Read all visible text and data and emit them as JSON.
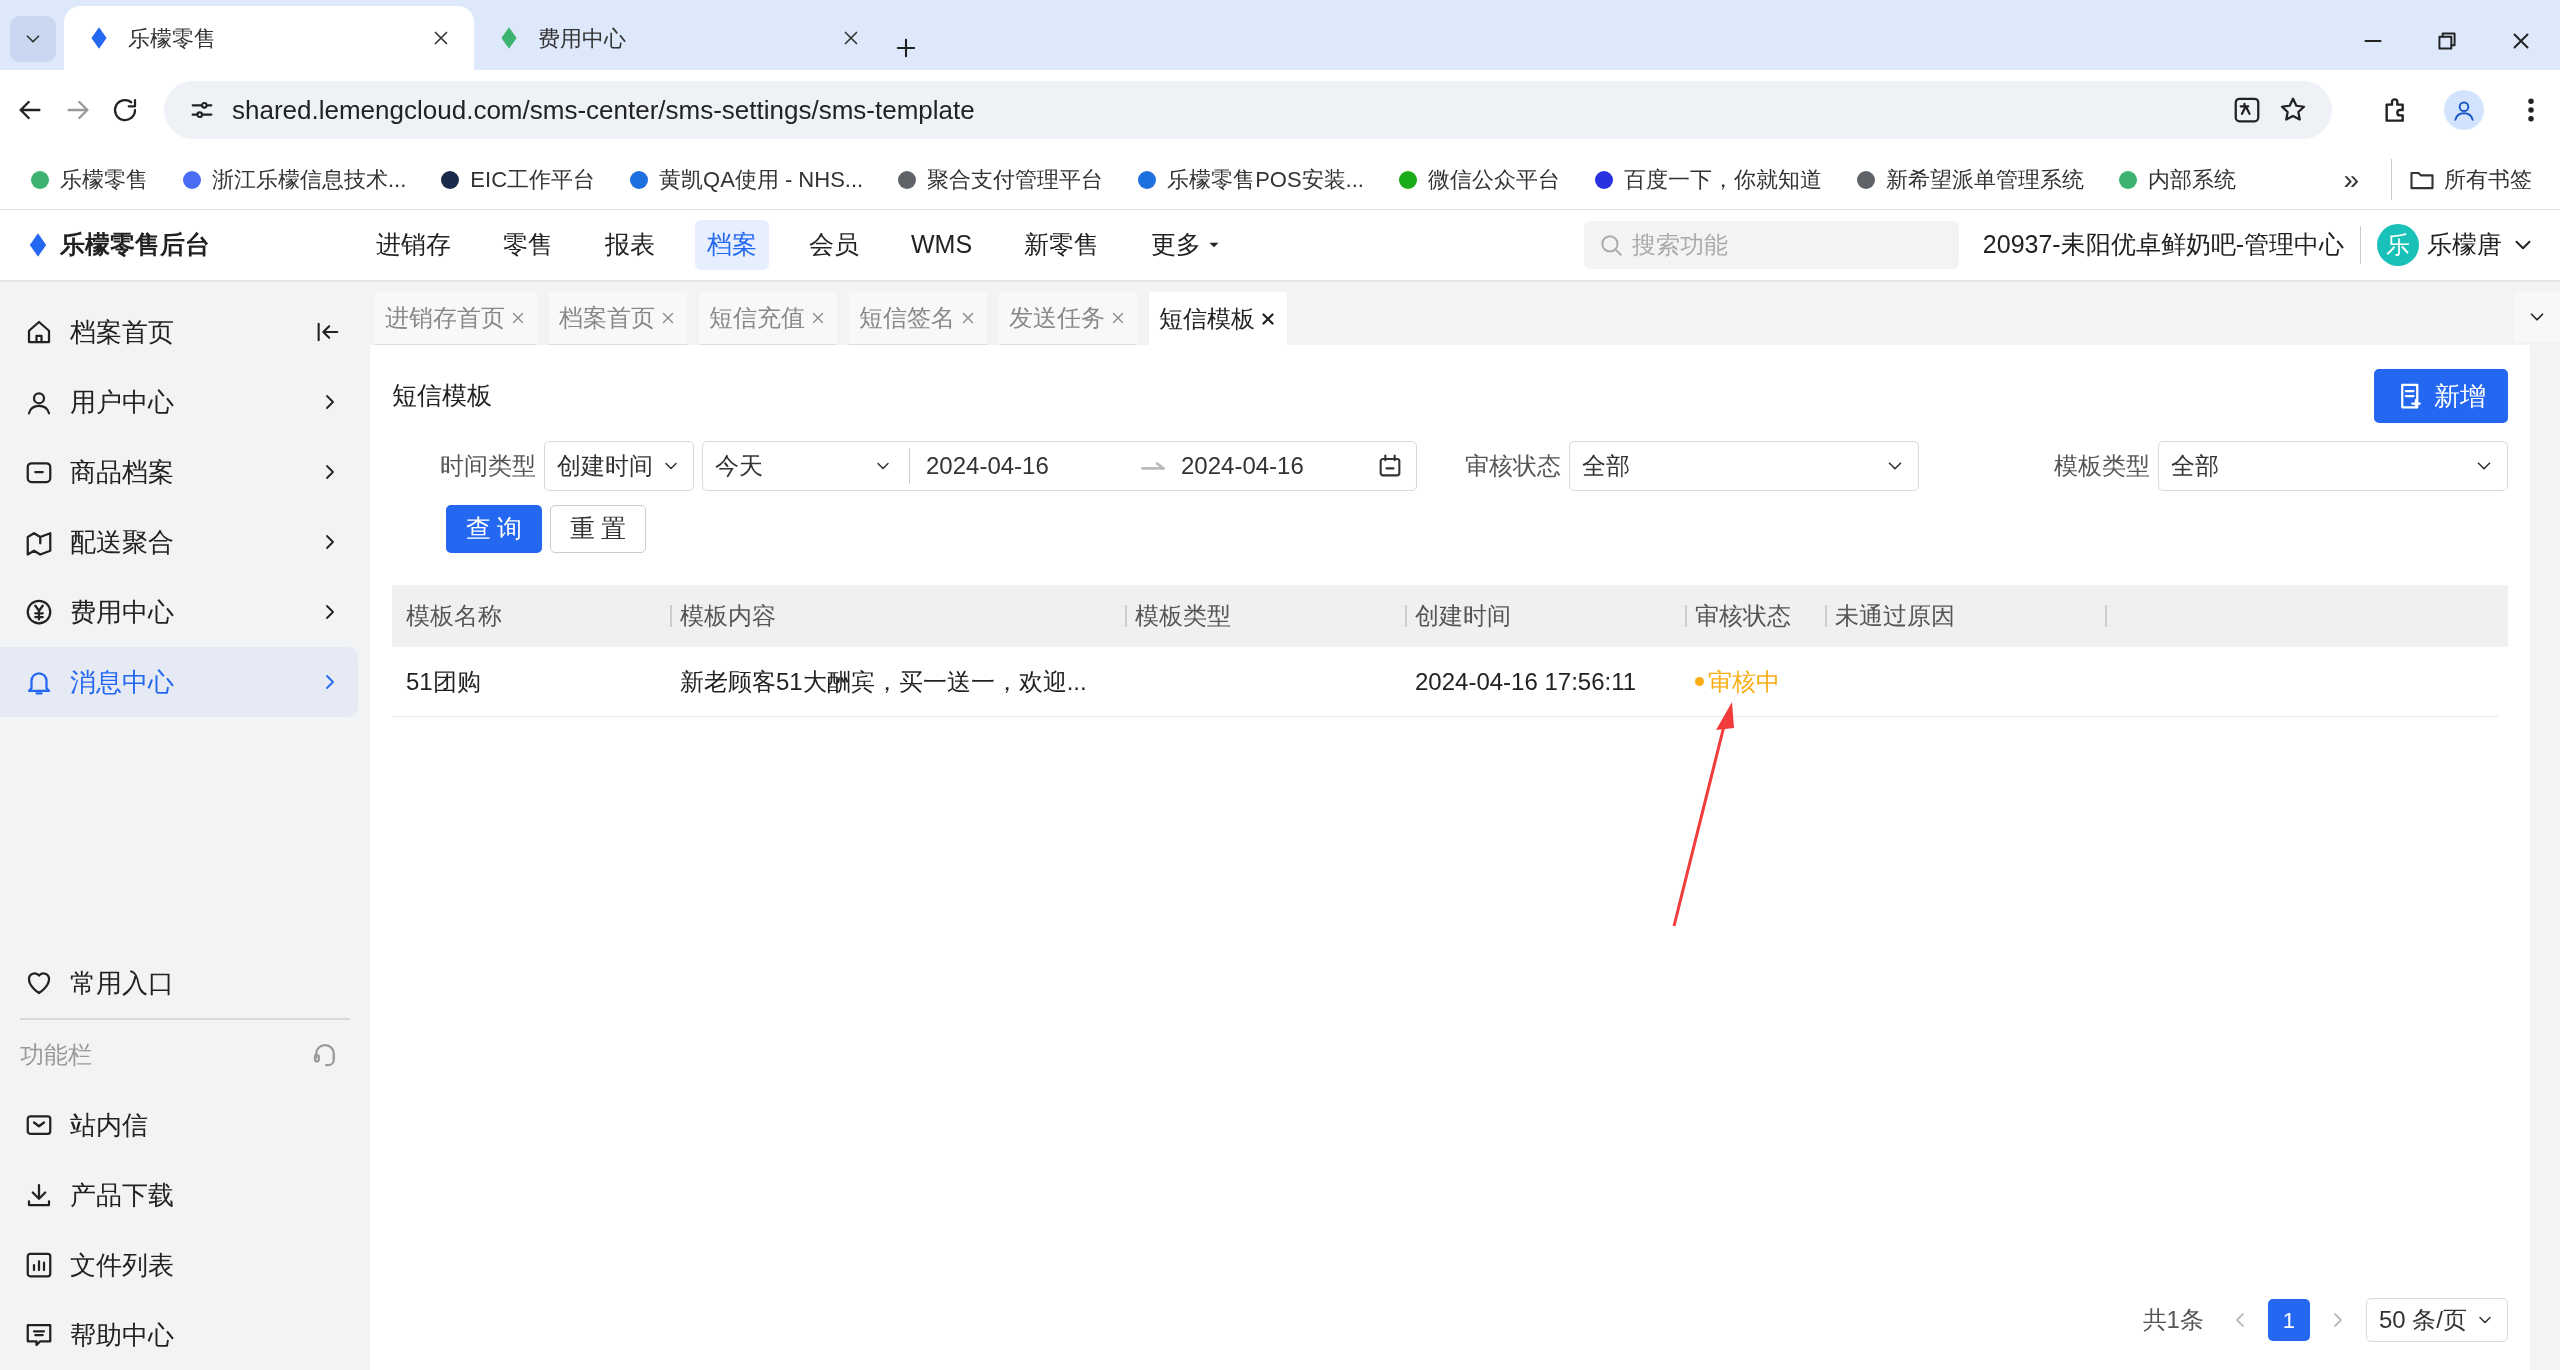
{
  "browser": {
    "tabs": [
      {
        "title": "乐檬零售",
        "selected": true
      },
      {
        "title": "费用中心",
        "selected": false
      }
    ],
    "url": "shared.lemengcloud.com/sms-center/sms-settings/sms-template",
    "bookmarks": [
      {
        "label": "乐檬零售",
        "color": "#3cb371"
      },
      {
        "label": "浙江乐檬信息技术...",
        "color": "#4a6cf7"
      },
      {
        "label": "EIC工作平台",
        "color": "#1a2a4a"
      },
      {
        "label": "黄凯QA使用 - NHS...",
        "color": "#1e6fe0"
      },
      {
        "label": "聚合支付管理平台",
        "color": "#5f6368"
      },
      {
        "label": "乐檬零售POS安装...",
        "color": "#1e6fe0"
      },
      {
        "label": "微信公众平台",
        "color": "#1aad19"
      },
      {
        "label": "百度一下，你就知道",
        "color": "#2932e1"
      },
      {
        "label": "新希望派单管理系统",
        "color": "#5f6368"
      },
      {
        "label": "内部系统",
        "color": "#3cb371"
      }
    ],
    "more_bookmarks": "»",
    "all_bookmarks": "所有书签"
  },
  "app": {
    "logo": "乐檬零售后台",
    "nav": [
      {
        "label": "进销存",
        "selected": false
      },
      {
        "label": "零售",
        "selected": false
      },
      {
        "label": "报表",
        "selected": false
      },
      {
        "label": "档案",
        "selected": true
      },
      {
        "label": "会员",
        "selected": false
      },
      {
        "label": "WMS",
        "selected": false
      },
      {
        "label": "新零售",
        "selected": false
      },
      {
        "label": "更多",
        "selected": false
      }
    ],
    "search": {
      "placeholder": "搜索功能"
    },
    "store": "20937-耒阳优卓鲜奶吧-管理中心",
    "avatar": "乐",
    "user": "乐檬唐"
  },
  "sidebar": {
    "items": [
      {
        "label": "档案首页",
        "kind": "collapse",
        "selected": false
      },
      {
        "label": "用户中心",
        "kind": "submenu",
        "selected": false
      },
      {
        "label": "商品档案",
        "kind": "submenu",
        "selected": false
      },
      {
        "label": "配送聚合",
        "kind": "submenu",
        "selected": false
      },
      {
        "label": "费用中心",
        "kind": "submenu",
        "selected": false
      },
      {
        "label": "消息中心",
        "kind": "submenu",
        "selected": true
      }
    ],
    "favorites": "常用入口",
    "section": "功能栏",
    "tools": [
      "站内信",
      "产品下载",
      "文件列表",
      "帮助中心"
    ]
  },
  "page_tabs": [
    {
      "label": "进销存首页",
      "selected": false
    },
    {
      "label": "档案首页",
      "selected": false
    },
    {
      "label": "短信充值",
      "selected": false
    },
    {
      "label": "短信签名",
      "selected": false
    },
    {
      "label": "发送任务",
      "selected": false
    },
    {
      "label": "短信模板",
      "selected": true
    }
  ],
  "page": {
    "title": "短信模板",
    "add_button": "新增",
    "filters": {
      "time_type_label": "时间类型",
      "time_type": "创建时间",
      "preset": "今天",
      "start": "2024-04-16",
      "end": "2024-04-16",
      "status_label": "审核状态",
      "status": "全部",
      "type_label": "模板类型",
      "type": "全部"
    },
    "buttons": [
      "查 询",
      "重 置"
    ],
    "table": {
      "columns": [
        "模板名称",
        "模板内容",
        "模板类型",
        "创建时间",
        "审核状态",
        "未通过原因"
      ],
      "rows": [
        {
          "name": "51团购",
          "content": "新老顾客51大酬宾，买一送一，欢迎...",
          "created": "2024-04-16 17:56:11",
          "status": "审核中",
          "color": "#faad14"
        }
      ]
    },
    "pagination": {
      "total": "共1条",
      "pages": [
        {
          "label": "1",
          "selected": true
        }
      ],
      "page_size": "50 条/页"
    }
  }
}
